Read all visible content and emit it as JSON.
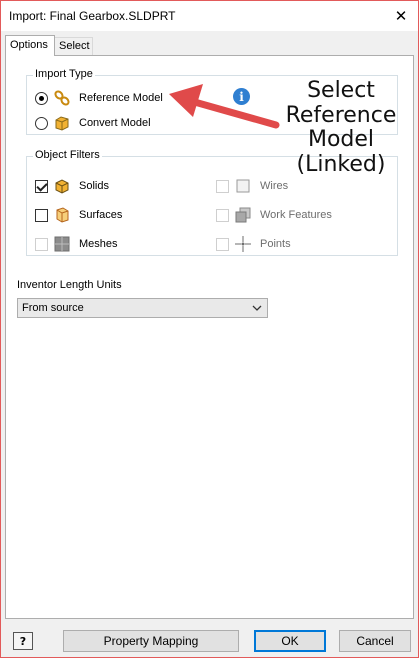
{
  "window": {
    "title": "Import:  Final Gearbox.SLDPRT",
    "close_symbol": "✕"
  },
  "tabs": [
    {
      "label": "Options"
    },
    {
      "label": "Select"
    }
  ],
  "import_type": {
    "title": "Import Type",
    "options": [
      {
        "label": "Reference Model",
        "checked": true,
        "icon": "reference-link-icon"
      },
      {
        "label": "Convert Model",
        "checked": false,
        "icon": "convert-model-icon"
      }
    ],
    "info_symbol": "i"
  },
  "annotation": {
    "lines": [
      "Select",
      "Reference",
      "Model",
      "(Linked)"
    ],
    "arrow_color": "#e04a4a"
  },
  "object_filters": {
    "title": "Object Filters",
    "items": [
      {
        "label": "Solids",
        "checked": true,
        "disabled": false,
        "icon": "solid-cube-icon"
      },
      {
        "label": "Surfaces",
        "checked": false,
        "disabled": false,
        "icon": "surface-icon"
      },
      {
        "label": "Meshes",
        "checked": false,
        "disabled": true,
        "icon": "mesh-icon"
      },
      {
        "label": "Wires",
        "checked": false,
        "disabled": true,
        "icon": "wire-icon"
      },
      {
        "label": "Work Features",
        "checked": false,
        "disabled": true,
        "icon": "work-features-icon"
      },
      {
        "label": "Points",
        "checked": false,
        "disabled": true,
        "icon": "point-icon"
      }
    ]
  },
  "length_units": {
    "label": "Inventor Length Units",
    "value": "From source"
  },
  "buttons": {
    "help": "?",
    "property_mapping": "Property Mapping",
    "ok": "OK",
    "cancel": "Cancel"
  },
  "colors": {
    "accent": "#0078d7",
    "window_border": "#e25a5a",
    "icon_orange": "#f2b233",
    "info_blue": "#2f7fd1"
  }
}
